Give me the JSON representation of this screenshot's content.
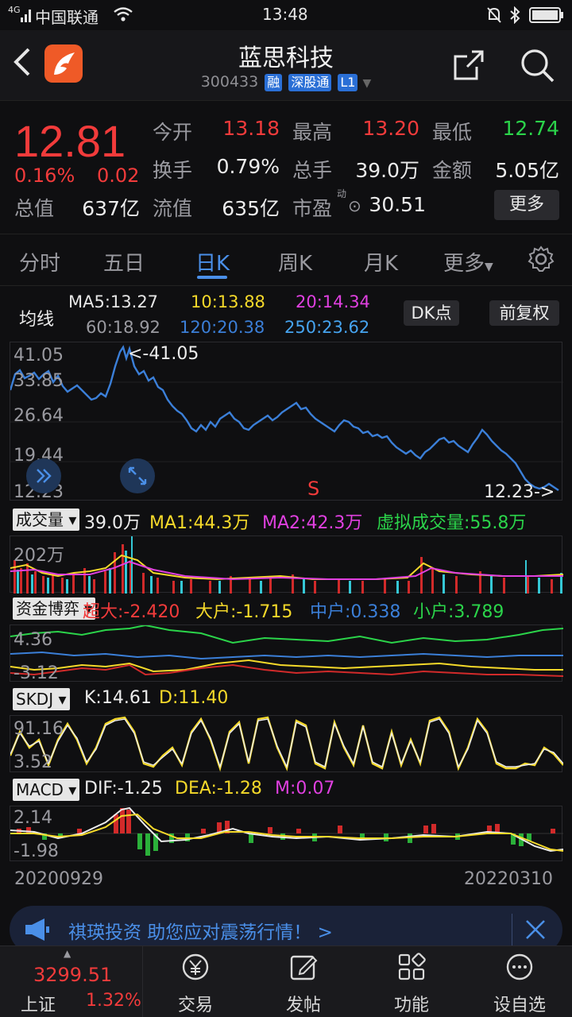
{
  "status": {
    "carrier": "中国联通",
    "signal": "4G",
    "time": "13:48"
  },
  "header": {
    "title": "蓝思科技",
    "code": "300433",
    "tags": [
      "融",
      "深股通",
      "L1"
    ]
  },
  "quote": {
    "price": "12.81",
    "chg_pct": "0.16%",
    "chg_abs": "0.02",
    "open_label": "今开",
    "open": "13.18",
    "high_label": "最高",
    "high": "13.20",
    "low_label": "最低",
    "low": "12.74",
    "turnover_label": "换手",
    "turnover": "0.79%",
    "volume_label": "总手",
    "volume": "39.0万",
    "amount_label": "金额",
    "amount": "5.05亿",
    "mktcap_label": "总值",
    "mktcap": "637亿",
    "float_label": "流值",
    "float": "635亿",
    "pe_label": "市盈",
    "pe_sup": "动",
    "pe": "30.51",
    "more": "更多"
  },
  "tabs": [
    "分时",
    "五日",
    "日K",
    "周K",
    "月K",
    "更多"
  ],
  "active_tab": "日K",
  "ma": {
    "label": "均线",
    "ma5": "MA5:13.27",
    "ma10": "10:13.88",
    "ma20": "20:14.34",
    "ma60": "60:18.92",
    "ma120": "120:20.38",
    "ma250": "250:23.62",
    "dk": "DK点",
    "fq": "前复权",
    "colors": {
      "ma5": "#e6e6e6",
      "ma10": "#f5d92a",
      "ma20": "#e040e0",
      "ma60": "#9a9aa0",
      "ma120": "#3b7fd8",
      "ma250": "#46a4f0"
    }
  },
  "kline": {
    "y_labels": [
      "41.05",
      "33.85",
      "26.64",
      "19.44",
      "12.23"
    ],
    "max_note": "<-41.05",
    "min_note": "12.23->",
    "signal": "S"
  },
  "volume": {
    "name": "成交量",
    "vol": "39.0万",
    "ma1": "MA1:44.3万",
    "ma2": "MA2:42.3万",
    "virtual": "虚拟成交量:55.8万",
    "y_label": "202万"
  },
  "fund": {
    "name": "资金博弈",
    "super": "超大:-2.420",
    "big": "大户:-1.715",
    "mid": "中户:0.338",
    "small": "小户:3.789",
    "y_top": "4.36",
    "y_bottom": "-3.12"
  },
  "skdj": {
    "name": "SKDJ",
    "k": "K:14.61",
    "d": "D:11.40",
    "y_top": "91.16",
    "y_bottom": "3.52"
  },
  "macd": {
    "name": "MACD",
    "dif": "DIF:-1.25",
    "dea": "DEA:-1.28",
    "m": "M:0.07",
    "y_top": "2.14",
    "y_bottom": "-1.98"
  },
  "dates": {
    "start": "20200929",
    "end": "20220310"
  },
  "banner": {
    "text": "祺瑛投资  助您应对震荡行情！ >"
  },
  "bottom": {
    "index_value": "3299.51",
    "index_name": "上证",
    "index_pct": "1.32%",
    "items": [
      "交易",
      "发帖",
      "功能",
      "设自选"
    ]
  }
}
